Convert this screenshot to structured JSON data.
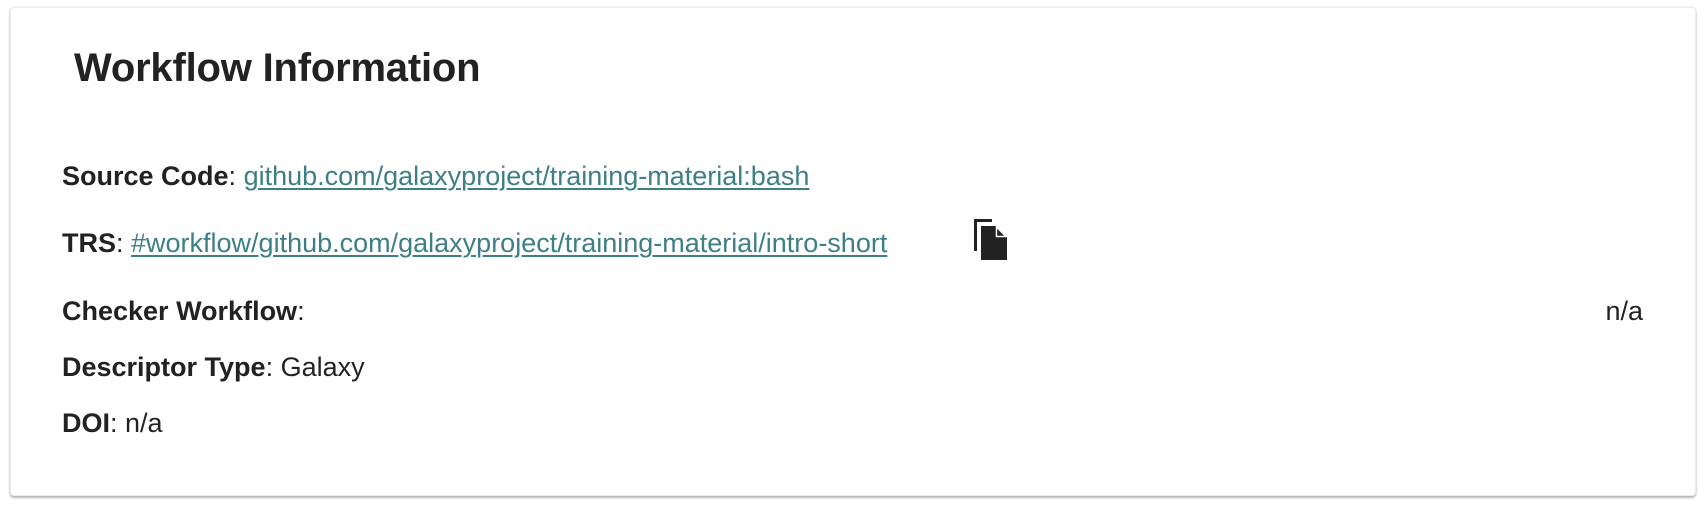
{
  "card": {
    "title": "Workflow Information"
  },
  "source_code": {
    "label": "Source Code",
    "separator": ": ",
    "link_text": "github.com/galaxyproject/training-material:bash"
  },
  "trs": {
    "label": "TRS",
    "separator": ": ",
    "link_text": "#workflow/github.com/galaxyproject/training-material/intro-short",
    "copy_icon": "copy-icon"
  },
  "checker_workflow": {
    "label": "Checker Workflow",
    "separator": ":",
    "value": "n/a"
  },
  "descriptor_type": {
    "label": "Descriptor Type",
    "separator": ": ",
    "value": "Galaxy"
  },
  "doi": {
    "label": "DOI",
    "separator": ": ",
    "value": "n/a"
  },
  "colors": {
    "link": "#3d7f86",
    "text": "#222222"
  }
}
